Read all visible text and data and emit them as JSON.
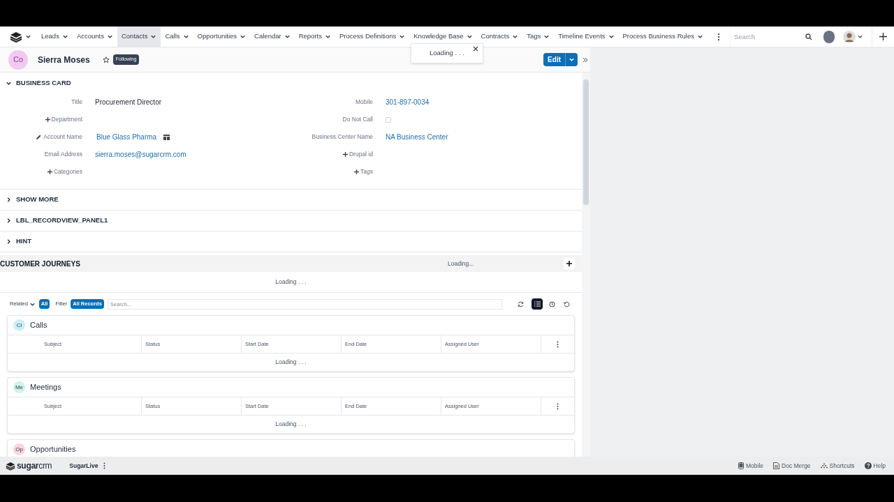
{
  "nav": {
    "items": [
      {
        "label": "Leads",
        "selected": false
      },
      {
        "label": "Accounts",
        "selected": false
      },
      {
        "label": "Contacts",
        "selected": true
      },
      {
        "label": "Calls",
        "selected": false
      },
      {
        "label": "Opportunities",
        "selected": false
      },
      {
        "label": "Calendar",
        "selected": false
      },
      {
        "label": "Reports",
        "selected": false
      },
      {
        "label": "Process Definitions",
        "selected": false
      },
      {
        "label": "Knowledge Base",
        "selected": false
      },
      {
        "label": "Contracts",
        "selected": false
      },
      {
        "label": "Tags",
        "selected": false
      },
      {
        "label": "Timeline Events",
        "selected": false
      },
      {
        "label": "Process Business Rules",
        "selected": false
      }
    ],
    "search": {
      "placeholder": "Search"
    }
  },
  "record": {
    "avatar": "Co",
    "name": "Sierra Moses",
    "following": "Following",
    "edit": "Edit"
  },
  "toast": {
    "text": "Loading . . ."
  },
  "business_card": {
    "title": "BUSINESS CARD",
    "expanded": true,
    "left_fields": [
      {
        "kind": "text",
        "label": "Title",
        "value": "Procurement Director"
      },
      {
        "kind": "add",
        "label": "Department"
      },
      {
        "kind": "account",
        "label": "Account Name",
        "value": "Blue Glass Pharma"
      },
      {
        "kind": "link",
        "label": "Email Address",
        "value": "sierra.moses@sugarcrm.com"
      },
      {
        "kind": "add",
        "label": "Categories"
      }
    ],
    "right_fields": [
      {
        "kind": "link",
        "label": "Mobile",
        "value": "301-897-0034"
      },
      {
        "kind": "checkbox",
        "label": "Do Not Call",
        "checked": false
      },
      {
        "kind": "link",
        "label": "Business Center Name",
        "value": "NA Business Center"
      },
      {
        "kind": "add",
        "label": "Drupal id"
      },
      {
        "kind": "add",
        "label": "Tags"
      }
    ]
  },
  "panels": [
    {
      "title": "SHOW MORE",
      "expanded": false
    },
    {
      "title": "LBL_RECORDVIEW_PANEL1",
      "expanded": false
    },
    {
      "title": "HINT",
      "expanded": false
    }
  ],
  "journeys": {
    "title": "CUSTOMER JOURNEYS",
    "status": "Loading...",
    "body": "Loading . . ."
  },
  "toolbar": {
    "related": "Related",
    "all": "All",
    "filter": "Filter",
    "all_records": "All Records",
    "placeholder": "Search...",
    "views": [
      {
        "kind": "list",
        "selected": true
      },
      {
        "kind": "history",
        "selected": false
      },
      {
        "kind": "undo",
        "selected": false
      }
    ]
  },
  "subpanels": [
    {
      "badge": "Cl",
      "color": "#cdeef6",
      "title": "Calls",
      "columns": [
        "Subject",
        "Status",
        "Start Date",
        "End Date",
        "Assigned User"
      ],
      "body": "Loading . . ."
    },
    {
      "badge": "Me",
      "color": "#cff3ea",
      "title": "Meetings",
      "columns": [
        "Subject",
        "Status",
        "Start Date",
        "End Date",
        "Assigned User"
      ],
      "body": "Loading . . ."
    },
    {
      "badge": "Op",
      "color": "#fbd5d9",
      "title": "Opportunities"
    }
  ],
  "footer": {
    "brand": "**sugar**crm",
    "app": "SugarLive",
    "links": [
      {
        "kind": "mobile",
        "label": "Mobile"
      },
      {
        "kind": "doc",
        "label": "Doc Merge"
      },
      {
        "kind": "shortcuts",
        "label": "Shortcuts"
      },
      {
        "kind": "help",
        "label": "Help"
      }
    ]
  }
}
